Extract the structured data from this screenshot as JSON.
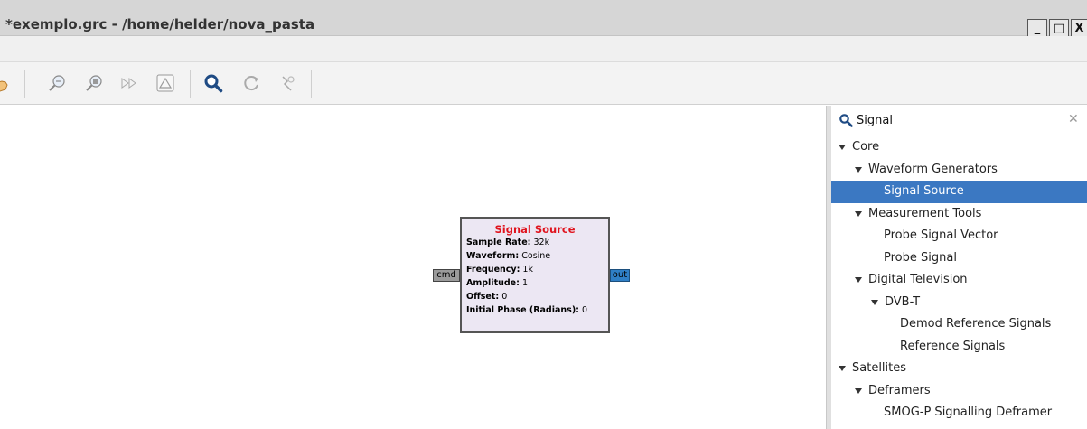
{
  "window": {
    "title": "*exemplo.grc - /home/helder/nova_pasta",
    "minimize_glyph": "_",
    "maximize_glyph": "□",
    "close_glyph": "X"
  },
  "toolbar": {
    "icons": [
      "hand-icon",
      "zoom-in-icon",
      "zoom-out-icon",
      "forward-icon",
      "warning-icon",
      "search-icon",
      "refresh-icon",
      "bypass-icon"
    ]
  },
  "block": {
    "title": "Signal Source",
    "params": [
      {
        "label": "Sample Rate:",
        "value": "32k"
      },
      {
        "label": "Waveform:",
        "value": "Cosine"
      },
      {
        "label": "Frequency:",
        "value": "1k"
      },
      {
        "label": "Amplitude:",
        "value": "1"
      },
      {
        "label": "Offset:",
        "value": "0"
      },
      {
        "label": "Initial Phase (Radians):",
        "value": "0"
      }
    ],
    "port_in": "cmd",
    "port_out": "out",
    "colors": {
      "title": "#e0141e",
      "body": "#ece7f3",
      "port_out": "#2f7fc6",
      "port_in": "#9b9b9b"
    }
  },
  "search": {
    "value": "Signal",
    "clear_glyph": "✕"
  },
  "tree": {
    "rows": [
      {
        "label": "Core",
        "expanded": true
      },
      {
        "label": "Waveform Generators",
        "expanded": true
      },
      {
        "label": "Signal Source",
        "selected": true
      },
      {
        "label": "Measurement Tools",
        "expanded": true
      },
      {
        "label": "Probe Signal Vector"
      },
      {
        "label": "Probe Signal"
      },
      {
        "label": "Digital Television",
        "expanded": true
      },
      {
        "label": "DVB-T",
        "expanded": true
      },
      {
        "label": "Demod Reference Signals"
      },
      {
        "label": "Reference Signals"
      },
      {
        "label": "Satellites",
        "expanded": true
      },
      {
        "label": "Deframers",
        "expanded": true
      },
      {
        "label": "SMOG-P Signalling Deframer"
      }
    ],
    "selection_color": "#3b78c2"
  }
}
